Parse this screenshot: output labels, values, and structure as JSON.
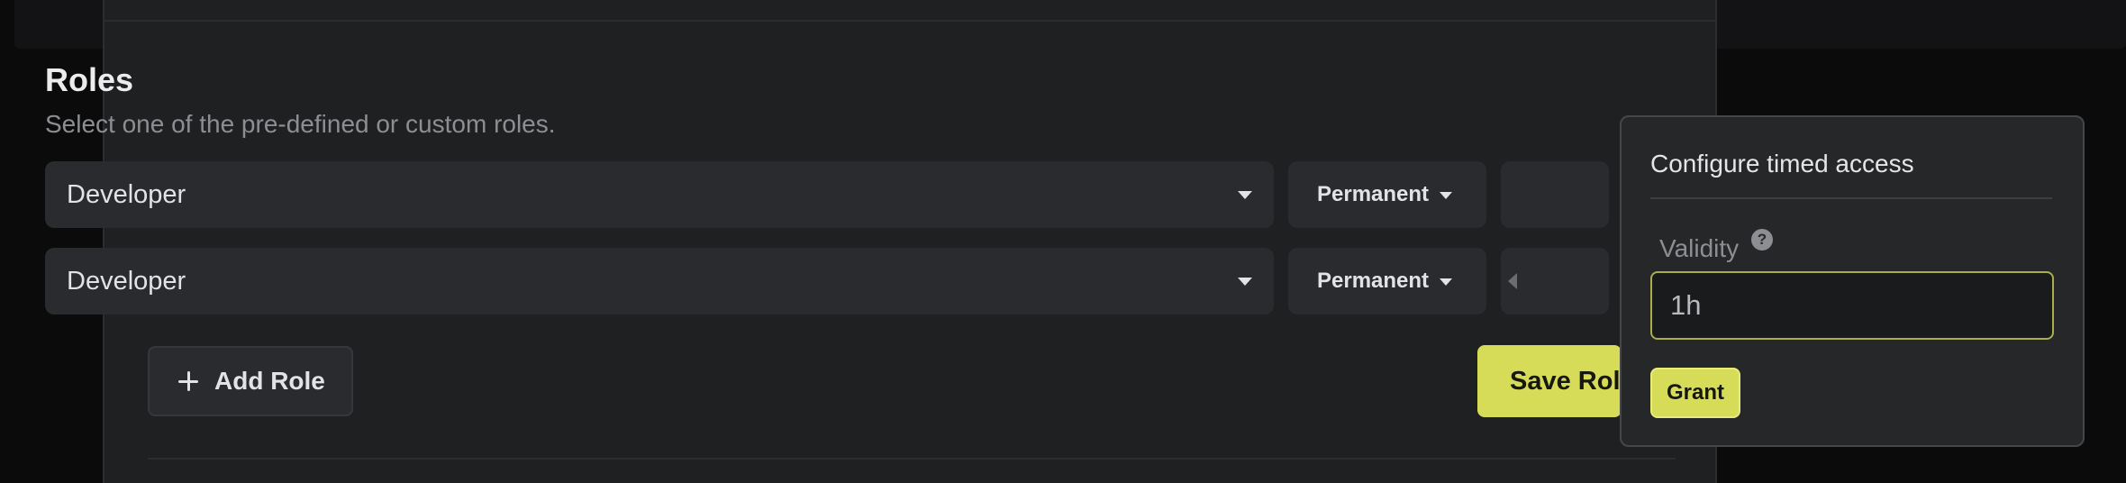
{
  "roles_section": {
    "title": "Roles",
    "subtitle": "Select one of the pre-defined or custom roles.",
    "rows": [
      {
        "role": "Developer",
        "duration": "Permanent"
      },
      {
        "role": "Developer",
        "duration": "Permanent"
      }
    ],
    "add_role_label": "Add Role",
    "save_roles_label": "Save Roles"
  },
  "popover": {
    "title": "Configure timed access",
    "validity_label": "Validity",
    "help_glyph": "?",
    "validity_value": "1h",
    "grant_label": "Grant"
  },
  "colors": {
    "accent": "#d6dc58",
    "panel_bg": "#1f2022",
    "input_bg": "#2a2b2e",
    "page_bg": "#0b0b0c"
  }
}
